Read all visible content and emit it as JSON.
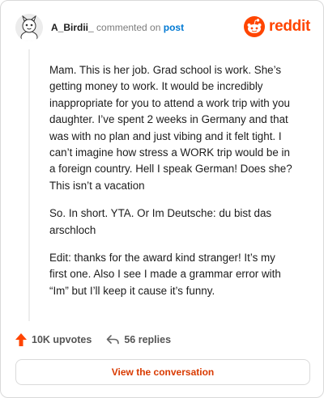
{
  "header": {
    "username": "A_Birdii_",
    "action": "commented on",
    "target": "post",
    "brand_name": "reddit"
  },
  "comment": {
    "paragraphs": [
      "Mam. This is her job. Grad school is work. She’s getting money to work. It would be incredibly inappropriate for you to attend a work trip with you daughter. I’ve spent 2 weeks in Germany and that was with no plan and just vibing and it felt tight. I can’t imagine how stress a WORK trip would be in a foreign country. Hell I speak German! Does she? This isn’t a vacation",
      "So. In short. YTA. Or Im Deutsche: du bist das arschloch",
      "Edit: thanks for the award kind stranger! It’s my first one. Also I see I made a grammar error with “Im” but I’ll keep it cause it’s funny."
    ]
  },
  "stats": {
    "upvotes": "10K upvotes",
    "replies": "56 replies"
  },
  "cta": {
    "label": "View the conversation"
  },
  "colors": {
    "accent": "#ff4500",
    "link": "#0079d3",
    "cta_text": "#d93a00",
    "upvote": "#ff4500"
  },
  "icons": {
    "avatar": "avatar",
    "brand": "reddit-logo-icon",
    "upvote": "upvote-arrow-icon",
    "reply": "reply-arrow-icon"
  }
}
